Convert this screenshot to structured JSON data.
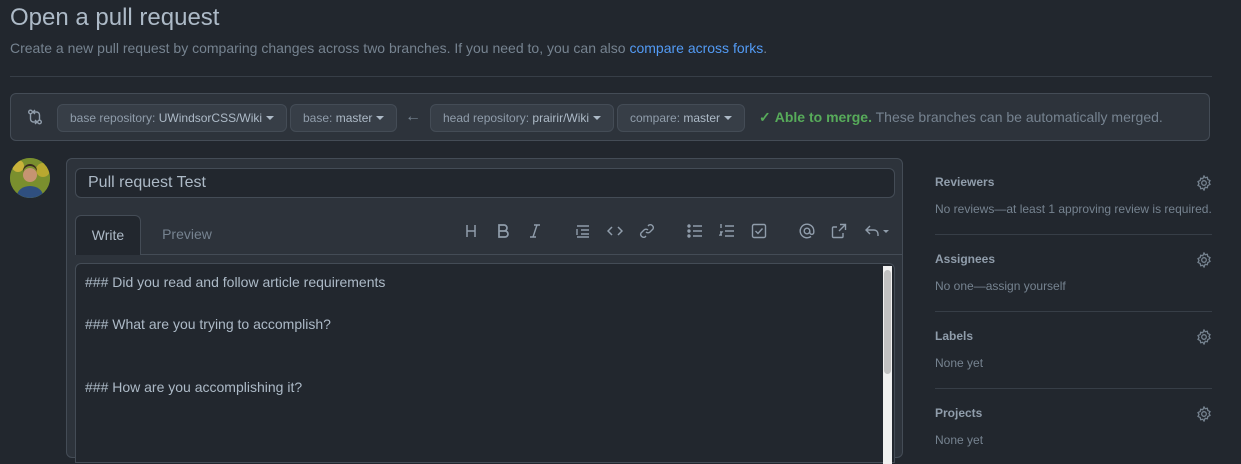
{
  "page": {
    "title": "Open a pull request",
    "subtitle_prefix": "Create a new pull request by comparing changes across two branches. If you need to, you can also ",
    "subtitle_link": "compare across forks",
    "subtitle_suffix": "."
  },
  "branches": {
    "base_repo_key": "base repository:",
    "base_repo_val": "UWindsorCSS/Wiki",
    "base_key": "base:",
    "base_val": "master",
    "head_repo_key": "head repository:",
    "head_repo_val": "prairir/Wiki",
    "compare_key": "compare:",
    "compare_val": "master",
    "merge_status": "Able to merge.",
    "merge_detail": "These branches can be automatically merged."
  },
  "editor": {
    "title_value": "Pull request Test",
    "tab_write": "Write",
    "tab_preview": "Preview",
    "body_lines": [
      "### Did you read and follow article requirements",
      "### What are you trying to accomplish?",
      "### How are you accomplishing it?"
    ]
  },
  "sidebar": {
    "reviewers": {
      "title": "Reviewers",
      "value": "No reviews—at least 1 approving review is required."
    },
    "assignees": {
      "title": "Assignees",
      "value": "No one—assign yourself"
    },
    "labels": {
      "title": "Labels",
      "value": "None yet"
    },
    "projects": {
      "title": "Projects",
      "value": "None yet"
    }
  },
  "colors": {
    "background": "#22272e",
    "link": "#539bf5",
    "success": "#57ab5a"
  }
}
